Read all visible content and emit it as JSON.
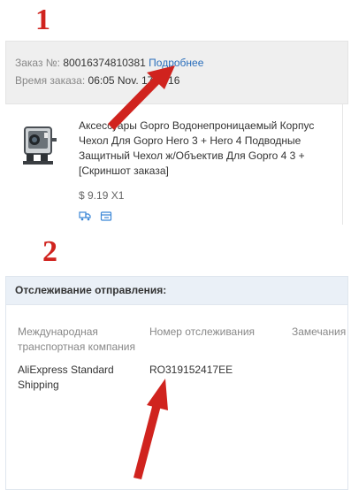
{
  "annotations": {
    "step1": "1",
    "step2": "2"
  },
  "order": {
    "number_label": "Заказ №:",
    "number_value": "80016374810381",
    "details_link": "Подробнее",
    "time_label": "Время заказа:",
    "time_value": "06:05 Nov. 17 2016"
  },
  "product": {
    "title": "Аксессуары Gopro Водонепроницаемый Корпус Чехол Для Gopro Hero 3 + Hero 4 Подводные Защитный Чехол ж/Объектив Для Gopro 4 3 + [Скриншот заказа]",
    "price": "$ 9.19 X1",
    "icons": [
      "shipping-truck-icon",
      "cart-icon"
    ]
  },
  "tracking": {
    "header": "Отслеживание отправления:",
    "columns": [
      "Международная транспортная компания",
      "Номер отслеживания",
      "Замечания"
    ],
    "row": {
      "carrier": "AliExpress Standard Shipping",
      "tracking_number": "RO319152417EE",
      "remarks": ""
    }
  },
  "colors": {
    "annotation_red": "#d0231e",
    "link_blue": "#2a6ebb",
    "order_bg": "#efefef",
    "tracking_header_bg": "#eaf0f7"
  }
}
